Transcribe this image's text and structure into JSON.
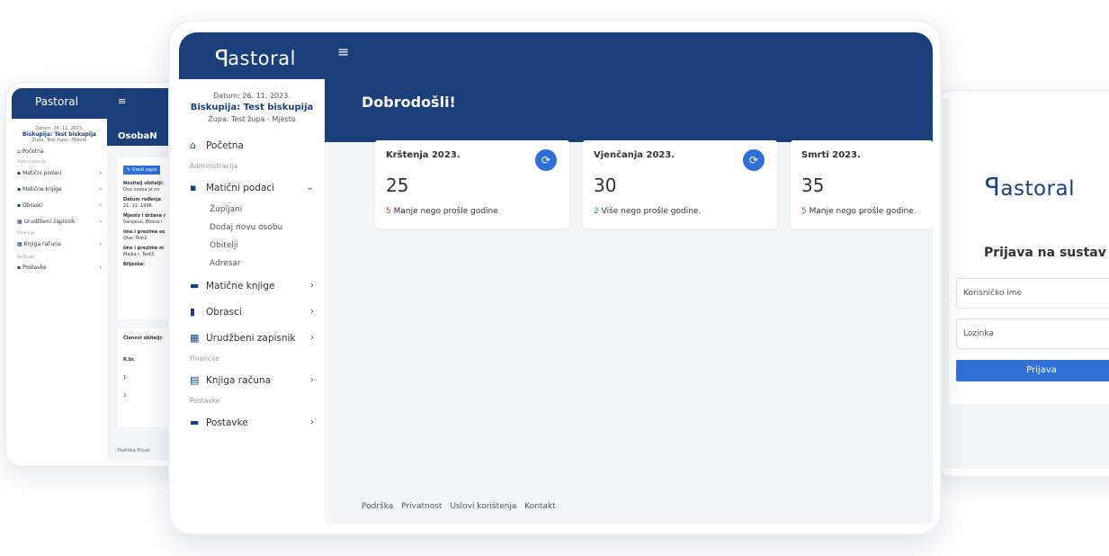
{
  "left_device": {
    "brand": "Pastoral",
    "date": "Datum: 26. 11. 2023.",
    "diocese": "Biskupija: Test biskupija",
    "parish": "Župa: Test župa - Mjesto",
    "nav": [
      {
        "label": "Početna"
      },
      {
        "label": "Administracija",
        "section": true
      },
      {
        "label": "Matični podaci"
      },
      {
        "label": "Matične knjige"
      },
      {
        "label": "Obrasci"
      },
      {
        "label": "Urudžbeni zapisnik"
      },
      {
        "label": "Financije",
        "section": true
      },
      {
        "label": "Knjiga računa"
      },
      {
        "label": "Postavke",
        "section": true
      },
      {
        "label": "Postavke"
      }
    ],
    "page_title": "OsobaN",
    "edit_button": "Uredi zapis",
    "fields": [
      {
        "label": "Nositelj obitelji:",
        "value": "Ova osoba je no"
      },
      {
        "label": "Datum rođenja",
        "value": "21. 11. 1996."
      },
      {
        "label": "Mjesto i država r",
        "value": "Sarajevo, Bosna i"
      },
      {
        "label": "Ime i prezime oc",
        "value": "Otac Test2"
      },
      {
        "label": "Ime i prezime m",
        "value": "Majka r. Test3"
      },
      {
        "label": "Bilješka:",
        "value": ""
      }
    ],
    "members_title": "Članovi obitelji:",
    "members_header": "R.br.",
    "members_rows": [
      "1.",
      "2."
    ],
    "footer": "Podrška  Privat"
  },
  "main": {
    "brand": "astoral",
    "date": "Datum: 26. 11. 2023.",
    "diocese": "Biskupija: Test biskupija",
    "parish": "Župa: Test župa - Mjesto",
    "welcome": "Dobrodošli!",
    "nav": {
      "home": "Početna",
      "admin_section": "Administracija",
      "maticni": "Matični podaci",
      "sub": [
        "Župljani",
        "Dodaj novu osobu",
        "Obitelji",
        "Adresar"
      ],
      "knjige": "Matične knjige",
      "obrasci": "Obrasci",
      "urudzbeni": "Urudžbeni zapisnik",
      "fin_section": "Financije",
      "racuni": "Knjiga računa",
      "post_section": "Postavke",
      "postavke": "Postavke"
    },
    "stats": [
      {
        "title": "Krštenja 2023.",
        "value": "25",
        "delta": "5",
        "note": "Manje nego prošle godine",
        "delta_color": "#d9342b"
      },
      {
        "title": "Vjenčanja 2023.",
        "value": "30",
        "delta": "2",
        "note": "Više nego prošle godine.",
        "delta_color": "#2e9e44"
      },
      {
        "title": "Smrti 2023.",
        "value": "35",
        "delta": "5",
        "note": "Manje nego prošle godine.",
        "delta_color": "#2e9e44"
      }
    ],
    "footer": [
      "Podrška",
      "Privatnost",
      "Uslovi korištenja",
      "Kontakt"
    ]
  },
  "right_device": {
    "brand": "astoral",
    "login_title": "Prijava na sustav",
    "username_placeholder": "Korisničko ime",
    "password_placeholder": "Lozinka",
    "login_button": "Prijava"
  },
  "colors": {
    "brand_blue": "#1b3f7a",
    "accent": "#2f6fd6"
  }
}
